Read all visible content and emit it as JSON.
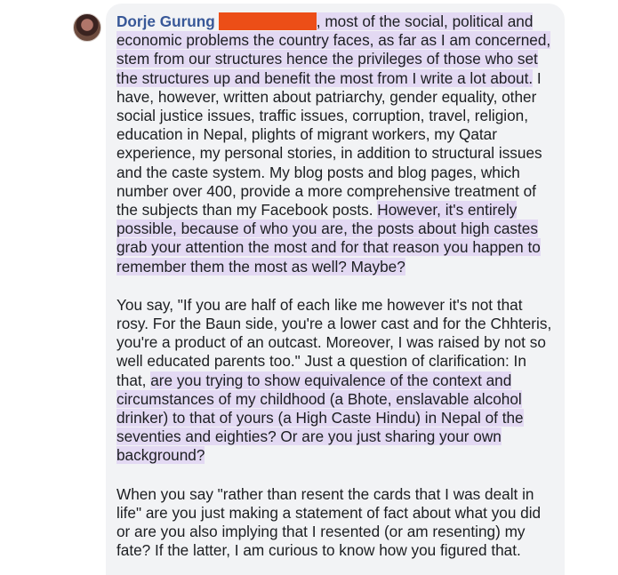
{
  "comment": {
    "author_name": "Dorje Gurung",
    "redaction_color": "#ec4e17",
    "highlight_color": "#e3d9f3",
    "paragraphs": [
      {
        "segments": [
          {
            "text": ", most of the social, political and economic problems the country faces, as far as I am concerned, stem from our structures hence the privileges of those who set the structures up and benefit the most from I write a lot about.",
            "highlighted": true
          },
          {
            "text": " I have, however, written about patriarchy, gender equality, other social justice issues, traffic issues, corruption, travel, religion, education in Nepal, plights of migrant workers, my Qatar experience, my personal stories, in addition to structural issues and the caste system. My blog posts and blog pages, which number over 400, provide a more comprehensive treatment of the subjects than my Facebook posts. ",
            "highlighted": false
          },
          {
            "text": "However, it's entirely possible, because of who you are, the posts about high castes grab your attention the most and for that reason you happen to remember them the most as well? Maybe?",
            "highlighted": true
          }
        ]
      },
      {
        "segments": [
          {
            "text": "You say, \"If you are half of each like me however it's not that rosy. For the Baun side, you're a lower cast and for the Chhteris, you're a product of an outcast. Moreover, I was raised by not so well educated parents too.\" Just a question of clarification: In that, ",
            "highlighted": false
          },
          {
            "text": "are you trying to show equivalence of the context and circumstances of my childhood (a Bhote, enslavable alcohol drinker) to that of yours (a High Caste Hindu) in Nepal of the seventies and eighties? Or are you just sharing your own background?",
            "highlighted": true
          }
        ]
      },
      {
        "segments": [
          {
            "text": "When you say \"rather than resent the cards that I was dealt in life\" are you just making a statement of fact about what you did or are you also implying that I resented (or am resenting) my fate? If the latter, I am curious to know how you figured that.",
            "highlighted": false
          }
        ]
      }
    ]
  }
}
